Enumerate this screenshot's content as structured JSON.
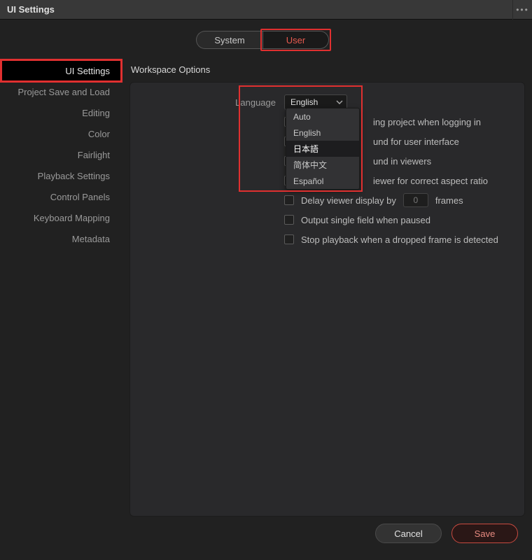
{
  "title": "UI Settings",
  "tabs": {
    "system": "System",
    "user": "User"
  },
  "sidebar": {
    "items": [
      "UI Settings",
      "Project Save and Load",
      "Editing",
      "Color",
      "Fairlight",
      "Playback Settings",
      "Control Panels",
      "Keyboard Mapping",
      "Metadata"
    ],
    "activeIndex": 0
  },
  "section": "Workspace Options",
  "language": {
    "label": "Language",
    "selected": "English",
    "options": [
      "Auto",
      "English",
      "日本語",
      "简体中文",
      "Español"
    ],
    "hoverIndex": 2
  },
  "checks": [
    {
      "label_suffix": "ing project when logging in"
    },
    {
      "label_suffix": "und for user interface"
    },
    {
      "label_suffix": "und in viewers"
    },
    {
      "label_suffix": "iewer for correct aspect ratio"
    }
  ],
  "delay": {
    "prefix": "Delay viewer display by",
    "value": "0",
    "suffix": "frames"
  },
  "checks2": [
    "Output single field when paused",
    "Stop playback when a dropped frame is detected"
  ],
  "footer": {
    "cancel": "Cancel",
    "save": "Save"
  }
}
